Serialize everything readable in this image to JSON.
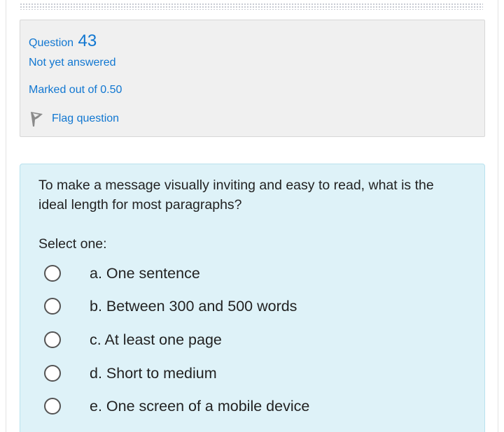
{
  "question_info": {
    "label": "Question",
    "number": "43",
    "state": "Not yet answered",
    "marked": "Marked out of 0.50",
    "flag_label": "Flag question"
  },
  "question": {
    "text": "To make a message visually inviting and easy to read, what is the ideal length for most paragraphs?",
    "select_label": "Select one:",
    "answers": [
      {
        "label": "a. One sentence"
      },
      {
        "label": "b. Between 300 and 500 words"
      },
      {
        "label": "c. At least one page"
      },
      {
        "label": "d. Short to medium"
      },
      {
        "label": "e. One screen of a mobile device"
      }
    ]
  },
  "colors": {
    "link_blue": "#1177d1",
    "info_bg": "#f0f0f0",
    "question_bg": "#def2f8"
  }
}
